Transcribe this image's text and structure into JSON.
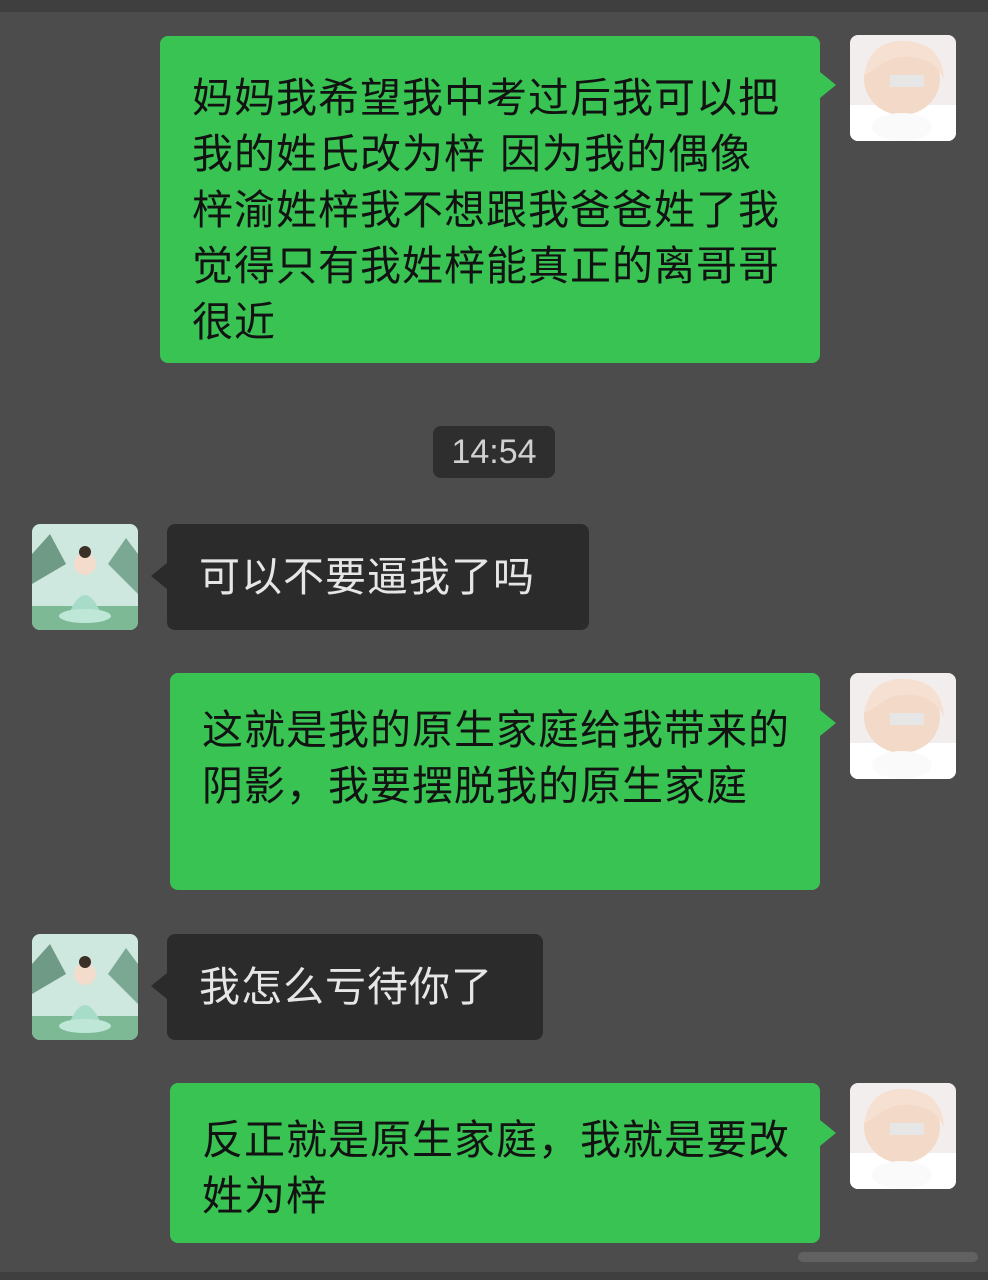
{
  "chat": {
    "timestamp": "14:54",
    "messages": [
      {
        "sender": "me",
        "text": "妈妈我希望我中考过后我可以把我的姓氏改为梓 因为我的偶像梓渝姓梓我不想跟我爸爸姓了我觉得只有我姓梓能真正的离哥哥很近"
      },
      {
        "sender": "mom",
        "text": "可以不要逼我了吗"
      },
      {
        "sender": "me",
        "text": "这就是我的原生家庭给我带来的阴影，我要摆脱我的原生家庭"
      },
      {
        "sender": "mom",
        "text": "我怎么亏待你了"
      },
      {
        "sender": "me",
        "text": "反正就是原生家庭，我就是要改姓为梓"
      }
    ]
  },
  "colors": {
    "background": "#4c4c4c",
    "outgoing_bubble": "#38c353",
    "incoming_bubble": "#2b2b2b",
    "timestamp_bg": "#2e2e2e"
  },
  "icons": {
    "my_avatar": "blond-person-avatar-icon",
    "mom_avatar": "meditating-figure-landscape-avatar-icon"
  }
}
